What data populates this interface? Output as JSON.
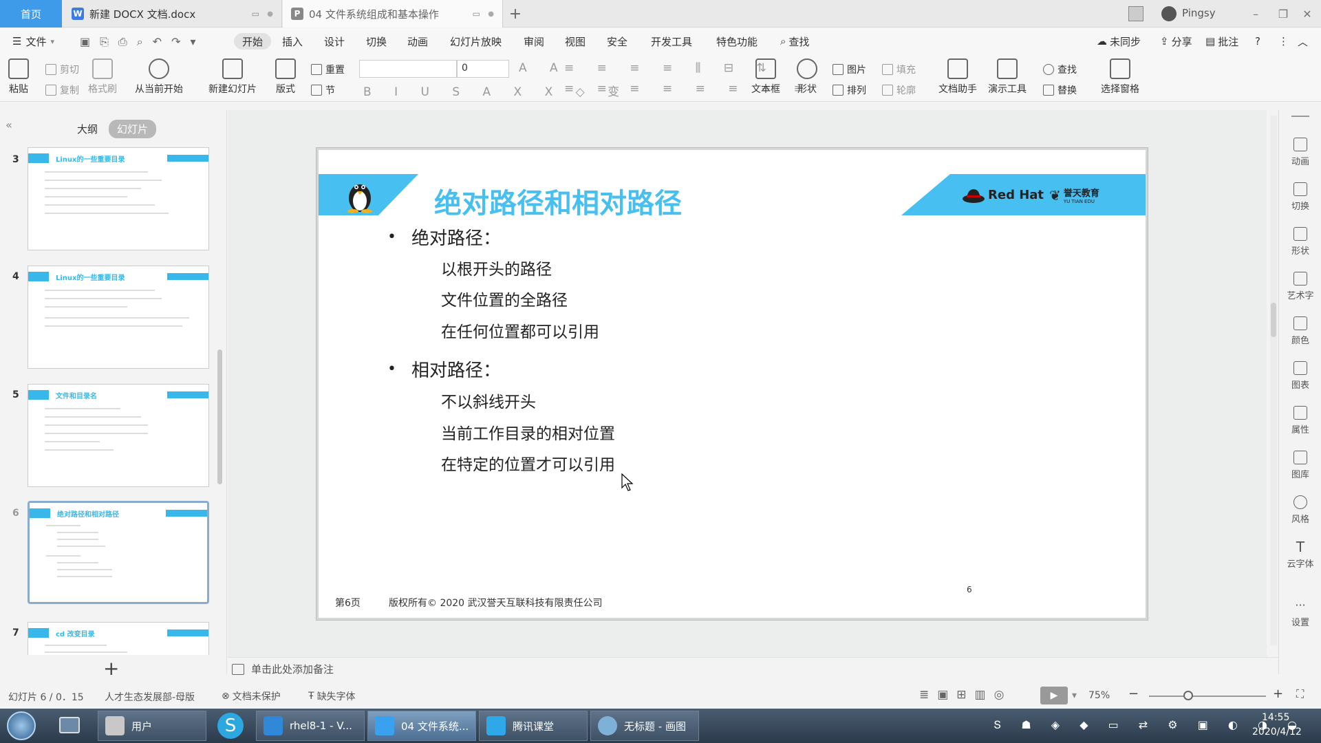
{
  "titlebar": {
    "home": "首页",
    "tabs": [
      {
        "label": "新建 DOCX 文档.docx",
        "icon": "W",
        "color": "#3d7be0"
      },
      {
        "label": "04 文件系统组成和基本操作",
        "icon": "P",
        "color": "#888888"
      }
    ],
    "user": "Pingsy"
  },
  "menu": {
    "file": "文件",
    "items": [
      "开始",
      "插入",
      "设计",
      "切换",
      "动画",
      "幻灯片放映",
      "审阅",
      "视图",
      "安全",
      "开发工具",
      "特色功能",
      "查找"
    ],
    "right": [
      "未同步",
      "分享",
      "批注"
    ]
  },
  "ribbon": {
    "paste": "粘贴",
    "cut": "剪切",
    "copy": "复制",
    "format_painter": "格式刷",
    "from_current": "从当前开始",
    "new_slide": "新建幻灯片",
    "layout": "版式",
    "reset": "重置",
    "section": "节",
    "font_size": "0",
    "textbox": "文本框",
    "shape": "形状",
    "picture": "图片",
    "fill": "填充",
    "arrange": "排列",
    "outline": "轮廓",
    "doc_helper": "文档助手",
    "presenter": "演示工具",
    "find": "查找",
    "replace": "替换",
    "select_pane": "选择窗格"
  },
  "left_panel": {
    "tab_outline": "大纲",
    "tab_slides": "幻灯片",
    "thumbs": [
      {
        "num": "3",
        "title": "Linux的一些重要目录"
      },
      {
        "num": "4",
        "title": "Linux的一些重要目录"
      },
      {
        "num": "5",
        "title": "文件和目录名"
      },
      {
        "num": "6",
        "title": "绝对路径和相对路径"
      },
      {
        "num": "7",
        "title": "cd 改变目录"
      }
    ]
  },
  "slide": {
    "title": "绝对路径和相对路径",
    "logo_text": "Red Hat",
    "logo_cn": "誉天教育",
    "logo_en": "YU TIAN EDU",
    "bullets": [
      {
        "label": "绝对路径：",
        "items": [
          "以根开头的路径",
          "文件位置的全路径",
          "在任何位置都可以引用"
        ]
      },
      {
        "label": "相对路径：",
        "items": [
          "不以斜线开头",
          "当前工作目录的相对位置",
          "在特定的位置才可以引用"
        ]
      }
    ],
    "page_label": "第6页",
    "copyright": "版权所有© 2020 武汉誉天互联科技有限责任公司",
    "page_num": "6"
  },
  "right_bar": [
    "动画",
    "切换",
    "形状",
    "艺术字",
    "颜色",
    "图表",
    "属性",
    "图库",
    "风格",
    "云字体",
    "设置"
  ],
  "notes": "单击此处添加备注",
  "status": {
    "slide_info": "幻灯片 6 / 0．15",
    "template": "人才生态发展部-母版",
    "protect": "文档未保护",
    "font_missing": "缺失字体",
    "zoom": "75%"
  },
  "taskbar": {
    "items": [
      {
        "label": "用户",
        "color": "#c8c8c8"
      },
      {
        "label": "rhel8-1 - V...",
        "color": "#2f88d8"
      },
      {
        "label": "04 文件系统...",
        "color": "#3aa0f0"
      },
      {
        "label": "腾讯课堂",
        "color": "#2ea8e8"
      },
      {
        "label": "无标题 - 画图",
        "color": "#7fb1d8"
      }
    ],
    "time": "14:55",
    "date": "2020/4/12"
  }
}
